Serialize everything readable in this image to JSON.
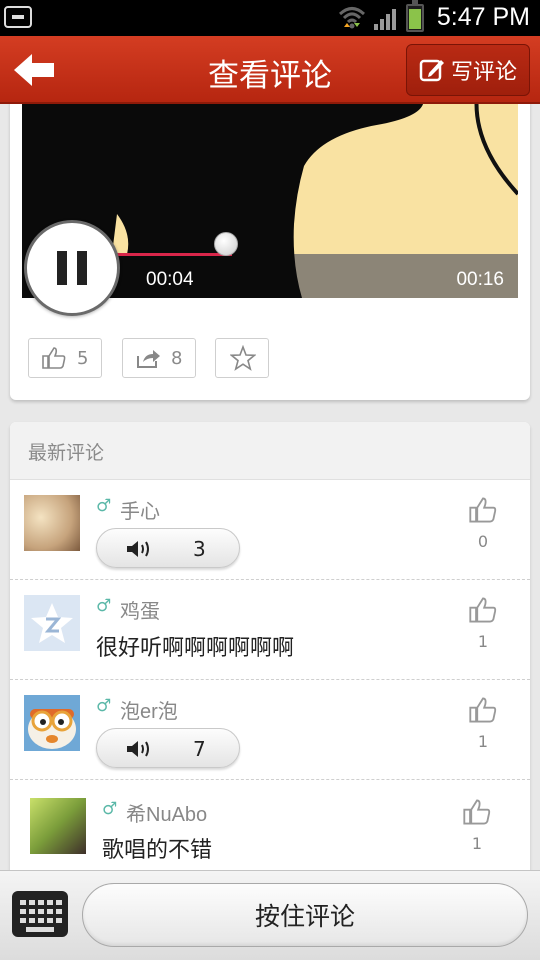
{
  "status_bar": {
    "time": "5:47 PM"
  },
  "header": {
    "title": "查看评论",
    "write_label": "写评论"
  },
  "player": {
    "current_time": "00:04",
    "total_time": "00:16",
    "progress": 0.25
  },
  "actions": {
    "like_count": "5",
    "share_count": "8"
  },
  "comments": {
    "section_title": "最新评论",
    "items": [
      {
        "gender": "♂",
        "name": "手心",
        "type": "voice",
        "voice_count": "3",
        "likes": "0"
      },
      {
        "gender": "♂",
        "name": "鸡蛋",
        "type": "text",
        "text": "很好听啊啊啊啊啊啊",
        "likes": "1"
      },
      {
        "gender": "♂",
        "name": "泡er泡",
        "type": "voice",
        "voice_count": "7",
        "likes": "1"
      },
      {
        "gender": "♂",
        "name": "希NuAbo",
        "type": "text",
        "text": "歌唱的不错",
        "likes": "1"
      }
    ]
  },
  "bottom": {
    "hold_label": "按住评论"
  },
  "colors": {
    "header": "#c3301a",
    "accent_progress": "#d9264a",
    "gender": "#5bb8a8"
  },
  "icons": [
    "back-arrow-icon",
    "edit-icon",
    "pause-icon",
    "thumb-up-icon",
    "share-icon",
    "star-icon",
    "speaker-icon",
    "keyboard-icon"
  ]
}
